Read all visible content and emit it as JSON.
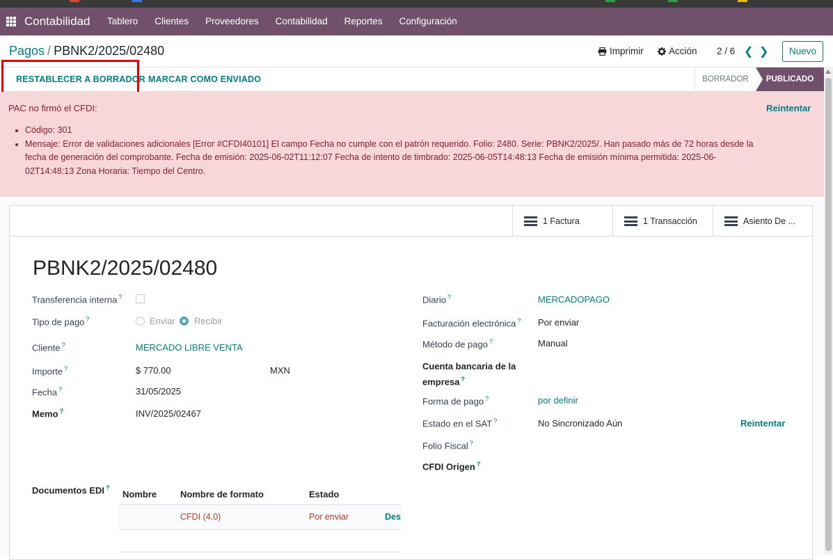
{
  "app": {
    "brand": "Contabilidad",
    "menu": [
      "Tablero",
      "Clientes",
      "Proveedores",
      "Contabilidad",
      "Reportes",
      "Configuración"
    ],
    "nav_color": "#71506b",
    "accent_color": "#017e84"
  },
  "control": {
    "breadcrumb_parent": "Pagos",
    "breadcrumb_sep": "/",
    "breadcrumb_current": "PBNK2/2025/02480",
    "print_label": "Imprimir",
    "action_label": "Acción",
    "pager": "2 / 6",
    "new_label": "Nuevo"
  },
  "statusbar": {
    "reset_label": "RESTABLECER A BORRADOR",
    "mark_sent_label": "MARCAR COMO ENVIADO",
    "stages": [
      "BORRADOR",
      "PUBLICADO"
    ],
    "active_stage": "PUBLICADO"
  },
  "alert": {
    "title": "PAC no firmó el CFDI:",
    "retry_label": "Reintentar",
    "items": [
      "Código: 301",
      "Mensaje: Error de validaciones adicionales [Error #CFDI40101] El campo Fecha no cumple con el patrón requerido. Folio: 2480. Serie: PBNK2/2025/. Han pasado más de 72 horas desde la fecha de generación del comprobante. Fecha de emisión: 2025-06-02T11:12:07 Fecha de intento de timbrado: 2025-06-05T14:48:13 Fecha de emisión mínima permitida: 2025-06-02T14:48:13 Zona Horaria: Tiempo del Centro."
    ]
  },
  "smart_buttons": [
    "1 Factura",
    "1 Transacción",
    "Asiento De ..."
  ],
  "form": {
    "title": "PBNK2/2025/02480",
    "left": {
      "internal_transfer_label": "Transferencia interna",
      "payment_type_label": "Tipo de pago",
      "send_label": "Enviar",
      "receive_label": "Recibir",
      "customer_label": "Cliente",
      "customer_value": "MERCADO LIBRE VENTA",
      "amount_label": "Importe",
      "amount_value": "$ 770.00",
      "currency_value": "MXN",
      "date_label": "Fecha",
      "date_value": "31/05/2025",
      "memo_label": "Memo",
      "memo_value": "INV/2025/02467"
    },
    "right": {
      "journal_label": "Diario",
      "journal_value": "MERCADOPAGO",
      "einvoice_label": "Facturación electrónica",
      "einvoice_value": "Por enviar",
      "method_label": "Método de pago",
      "method_value": "Manual",
      "bank_label_line1": "Cuenta bancaria de la",
      "bank_label_line2": "empresa",
      "pay_form_label": "Forma de pago",
      "pay_form_value": "por definir",
      "sat_label": "Estado en el SAT",
      "sat_value": "No Sincronizado Aún",
      "sat_retry": "Reintentar",
      "fiscal_folio_label": "Folio Fiscal",
      "cfdi_origin_label": "CFDI Origen"
    },
    "edi": {
      "label": "Documentos EDI",
      "columns": [
        "Nombre",
        "Nombre de formato",
        "Estado"
      ],
      "row": {
        "name": "",
        "format": "CFDI (4.0)",
        "state": "Por enviar",
        "action": "Des"
      }
    },
    "help_mark": "?"
  }
}
